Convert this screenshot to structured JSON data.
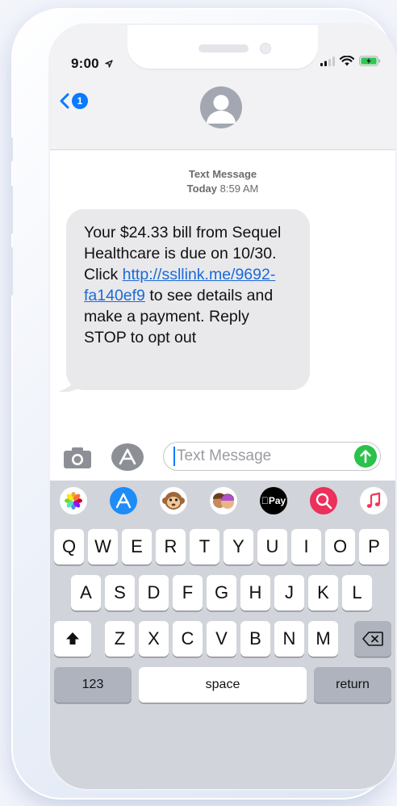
{
  "status_bar": {
    "time": "9:00"
  },
  "nav": {
    "back_badge": "1"
  },
  "thread": {
    "label": "Text Message",
    "day": "Today",
    "time": "8:59 AM"
  },
  "message": {
    "text_before": "Your $24.33 bill from Sequel Healthcare is due on 10/30. Click ",
    "link": "http://ssllink.me/9692-fa140ef9",
    "text_after": " to see details and make a payment. Reply STOP to opt out"
  },
  "composer": {
    "placeholder": "Text Message"
  },
  "app_drawer": [
    "photos-icon",
    "app-store-icon",
    "monkey-memoji-icon",
    "memoji-icon",
    "apple-pay-icon",
    "search-images-icon",
    "music-icon"
  ],
  "apple_pay_label": "Pay",
  "keyboard": {
    "row1": [
      "Q",
      "W",
      "E",
      "R",
      "T",
      "Y",
      "U",
      "I",
      "O",
      "P"
    ],
    "row2": [
      "A",
      "S",
      "D",
      "F",
      "G",
      "H",
      "J",
      "K",
      "L"
    ],
    "row3": [
      "Z",
      "X",
      "C",
      "V",
      "B",
      "N",
      "M"
    ],
    "numbers": "123",
    "space": "space",
    "return": "return"
  },
  "colors": {
    "accent": "#0a7aff",
    "link": "#1a6ad8",
    "send": "#29c24a",
    "bubble": "#e9e9eb"
  }
}
